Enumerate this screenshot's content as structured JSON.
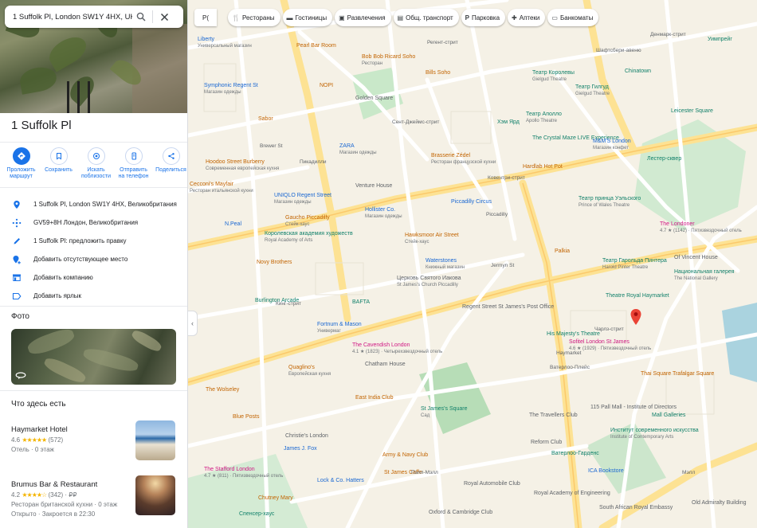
{
  "search": {
    "value": "1 Suffolk Pl, London SW1Y 4HX, UK"
  },
  "place": {
    "title": "1 Suffolk Pl"
  },
  "actions": [
    {
      "label": "Проложить маршрут",
      "icon": "directions-icon"
    },
    {
      "label": "Сохранить",
      "icon": "bookmark-icon"
    },
    {
      "label": "Искать поблизости",
      "icon": "nearby-icon"
    },
    {
      "label": "Отправить на телефон",
      "icon": "phone-icon"
    },
    {
      "label": "Поделиться",
      "icon": "share-icon"
    }
  ],
  "info": [
    {
      "text": "1 Suffolk Pl, London SW1Y 4HX, Великобритания",
      "icon": "location-pin-icon"
    },
    {
      "text": "GV59+8H Лондон, Великобритания",
      "icon": "plus-code-icon"
    },
    {
      "text": "1 Suffolk Pl: предложить правку",
      "icon": "pencil-icon"
    },
    {
      "text": "Добавить отсутствующее место",
      "icon": "add-place-icon"
    },
    {
      "text": "Добавить компанию",
      "icon": "store-icon"
    },
    {
      "text": "Добавить ярлык",
      "icon": "label-icon"
    }
  ],
  "photos": {
    "heading": "Фото"
  },
  "here": {
    "heading": "Что здесь есть",
    "items": [
      {
        "name": "Haymarket Hotel",
        "rating": "4.6",
        "stars": "★★★★★",
        "reviews": "(572)",
        "line1": "Отель · 0 этаж",
        "line2": ""
      },
      {
        "name": "Brumus Bar & Restaurant",
        "rating": "4.2",
        "stars": "★★★★☆",
        "reviews": "(342) · ₽₽",
        "line1": "Ресторан британской кухни · 0 этаж",
        "line2": "Открыто · Закроется в 22:30"
      }
    ]
  },
  "map": {
    "layer_label": "Р(",
    "chips": [
      {
        "label": "Рестораны",
        "icon": "fork-knife-icon"
      },
      {
        "label": "Гостиницы",
        "icon": "bed-icon"
      },
      {
        "label": "Развлечения",
        "icon": "ticket-icon"
      },
      {
        "label": "Общ. транспорт",
        "icon": "bus-icon"
      },
      {
        "label": "Парковка",
        "icon": "parking-icon"
      },
      {
        "label": "Аптеки",
        "icon": "pharmacy-icon"
      },
      {
        "label": "Банкоматы",
        "icon": "atm-icon"
      }
    ],
    "labels": [
      {
        "text": "Liberty",
        "sub": "Универсальный магазин",
        "cls": "t-blue"
      },
      {
        "text": "Pearl Bar Room",
        "sub": "",
        "cls": "t-orange"
      },
      {
        "text": "Bob Bob Ricard Soho",
        "sub": "Ресторан",
        "cls": "t-orange"
      },
      {
        "text": "Bills Soho",
        "sub": "",
        "cls": "t-orange"
      },
      {
        "text": "Театр Королевы",
        "sub": "Gielgud Theatre",
        "cls": "t-teal"
      },
      {
        "text": "Театр Гилгуд",
        "sub": "Gielgud Theatre",
        "cls": "t-teal"
      },
      {
        "text": "Chinatown",
        "sub": "",
        "cls": "t-teal"
      },
      {
        "text": "Уимпрейг",
        "sub": "",
        "cls": "t-teal"
      },
      {
        "text": "Symphonic Regent St",
        "sub": "Магазин одежды",
        "cls": "t-blue"
      },
      {
        "text": "NOPI",
        "sub": "",
        "cls": "t-orange"
      },
      {
        "text": "Golden Square",
        "sub": "",
        "cls": "t-grey"
      },
      {
        "text": "Театр Аполло",
        "sub": "Apollo Theatre",
        "cls": "t-teal"
      },
      {
        "text": "Sabor",
        "sub": "",
        "cls": "t-orange"
      },
      {
        "text": "Хэм Ярд",
        "sub": "",
        "cls": "t-teal"
      },
      {
        "text": "The Crystal Maze LIVE Experience",
        "sub": "",
        "cls": "t-teal"
      },
      {
        "text": "M&M'S London",
        "sub": "Магазин конфет",
        "cls": "t-blue"
      },
      {
        "text": "Leicester Square",
        "sub": "",
        "cls": "t-teal"
      },
      {
        "text": "ZARA",
        "sub": "Магазин одежды",
        "cls": "t-blue"
      },
      {
        "text": "Hoodoo Street Burberry",
        "sub": "Современная европейская кухня",
        "cls": "t-orange"
      },
      {
        "text": "Brasserie Zédel",
        "sub": "Ресторан французской кухни",
        "cls": "t-orange"
      },
      {
        "text": "Hardlab Hot Pot",
        "sub": "",
        "cls": "t-orange"
      },
      {
        "text": "Лестер-сквер",
        "sub": "",
        "cls": "t-teal"
      },
      {
        "text": "Театр принца Уэльского",
        "sub": "Prince of Wales Theatre",
        "cls": "t-teal"
      },
      {
        "text": "Cecconi's Mayfair",
        "sub": "Ресторан итальянской кухни",
        "cls": "t-orange"
      },
      {
        "text": "UNIQLO Regent Street",
        "sub": "Магазин одежды",
        "cls": "t-blue"
      },
      {
        "text": "Venture House",
        "sub": "",
        "cls": "t-grey"
      },
      {
        "text": "Piccadilly Circus",
        "sub": "",
        "cls": "t-blue"
      },
      {
        "text": "Piccadilly",
        "sub": "",
        "cls": "t-street"
      },
      {
        "text": "Hollister Co.",
        "sub": "Магазин одежды",
        "cls": "t-blue"
      },
      {
        "text": "Gaucho Piccadilly",
        "sub": "Стейк-хаус",
        "cls": "t-orange"
      },
      {
        "text": "Hawksmoor Air Street",
        "sub": "Стейк-хаус",
        "cls": "t-orange"
      },
      {
        "text": "The Londoner",
        "sub": "4.7 ★ (1142) · Пятизвездочный отель",
        "cls": "t-pink"
      },
      {
        "text": "N.Peal",
        "sub": "",
        "cls": "t-blue"
      },
      {
        "text": "Королевская академия художеств",
        "sub": "Royal Academy of Arts",
        "cls": "t-teal"
      },
      {
        "text": "Palkia",
        "sub": "",
        "cls": "t-orange"
      },
      {
        "text": "Театр Гарольда Пинтера",
        "sub": "Harold Pinter Theatre",
        "cls": "t-teal"
      },
      {
        "text": "Of Vincent House",
        "sub": "",
        "cls": "t-grey"
      },
      {
        "text": "Novy Brothers",
        "sub": "",
        "cls": "t-orange"
      },
      {
        "text": "Waterstones",
        "sub": "Книжный магазин",
        "cls": "t-blue"
      },
      {
        "text": "Национальная галерея",
        "sub": "The National Gallery",
        "cls": "t-teal"
      },
      {
        "text": "Церковь Святого Иакова",
        "sub": "St James's Church Piccadilly",
        "cls": "t-grey"
      },
      {
        "text": "Theatre Royal Haymarket",
        "sub": "",
        "cls": "t-teal"
      },
      {
        "text": "Burlington Arcade",
        "sub": "",
        "cls": "t-teal"
      },
      {
        "text": "BAFTA",
        "sub": "",
        "cls": "t-teal"
      },
      {
        "text": "Regent Street St James's Post Office",
        "sub": "",
        "cls": "t-grey"
      },
      {
        "text": "Fortnum & Mason",
        "sub": "Универмаг",
        "cls": "t-blue"
      },
      {
        "text": "His Majesty's Theatre",
        "sub": "",
        "cls": "t-teal"
      },
      {
        "text": "Sofitel London St James",
        "sub": "4.6 ★ (1929) · Пятизвездочный отель",
        "cls": "t-pink"
      },
      {
        "text": "The Cavendish London",
        "sub": "4.1 ★ (1823) · Четырехзвездочный отель",
        "cls": "t-pink"
      },
      {
        "text": "Chatham House",
        "sub": "",
        "cls": "t-grey"
      },
      {
        "text": "Quaglino's",
        "sub": "Европейская кухня",
        "cls": "t-orange"
      },
      {
        "text": "The Wolseley",
        "sub": "",
        "cls": "t-orange"
      },
      {
        "text": "Thai Square Trafalgar Square",
        "sub": "",
        "cls": "t-orange"
      },
      {
        "text": "East India Club",
        "sub": "",
        "cls": "t-orange"
      },
      {
        "text": "St James's Square",
        "sub": "Сад",
        "cls": "t-teal"
      },
      {
        "text": "The Travellers Club",
        "sub": "",
        "cls": "t-grey"
      },
      {
        "text": "115 Pall Mall - Institute of Directors",
        "sub": "",
        "cls": "t-grey"
      },
      {
        "text": "Mall Galleries",
        "sub": "",
        "cls": "t-teal"
      },
      {
        "text": "Blue Posts",
        "sub": "",
        "cls": "t-orange"
      },
      {
        "text": "Christie's London",
        "sub": "",
        "cls": "t-grey"
      },
      {
        "text": "Reform Club",
        "sub": "",
        "cls": "t-grey"
      },
      {
        "text": "Институт современного искусства",
        "sub": "Institute of Contemporary Arts",
        "cls": "t-teal"
      },
      {
        "text": "James J. Fox",
        "sub": "",
        "cls": "t-blue"
      },
      {
        "text": "Army & Navy Club",
        "sub": "",
        "cls": "t-orange"
      },
      {
        "text": "Ватерлоо-Гарденс",
        "sub": "",
        "cls": "t-teal"
      },
      {
        "text": "The Stafford London",
        "sub": "4.7 ★ (811) · Пятизвездочный отель",
        "cls": "t-pink"
      },
      {
        "text": "St James Caffe",
        "sub": "",
        "cls": "t-orange"
      },
      {
        "text": "Royal Automobile Club",
        "sub": "",
        "cls": "t-grey"
      },
      {
        "text": "Royal Academy of Engineering",
        "sub": "",
        "cls": "t-grey"
      },
      {
        "text": "ICA Bookstore",
        "sub": "",
        "cls": "t-blue"
      },
      {
        "text": "Lock & Co. Hatters",
        "sub": "",
        "cls": "t-blue"
      },
      {
        "text": "Chutney Mary",
        "sub": "",
        "cls": "t-orange"
      },
      {
        "text": "Oxford & Cambridge Club",
        "sub": "",
        "cls": "t-grey"
      },
      {
        "text": "South African Royal Embassy",
        "sub": "",
        "cls": "t-grey"
      },
      {
        "text": "Old Admiralty Building",
        "sub": "",
        "cls": "t-grey"
      },
      {
        "text": "Спенсер-хаус",
        "sub": "",
        "cls": "t-teal"
      },
      {
        "text": "Jermyn St",
        "sub": "",
        "cls": "t-street"
      },
      {
        "text": "Пэлл-Мэлл",
        "sub": "",
        "cls": "t-street"
      },
      {
        "text": "Ватерлоо-Плейс",
        "sub": "",
        "cls": "t-street"
      },
      {
        "text": "Ковентри-стрит",
        "sub": "",
        "cls": "t-street"
      },
      {
        "text": "Денмарк-стрит",
        "sub": "",
        "cls": "t-street"
      },
      {
        "text": "Чарлз-стрит",
        "sub": "",
        "cls": "t-street"
      },
      {
        "text": "Пикадилли",
        "sub": "",
        "cls": "t-street"
      },
      {
        "text": "Сент-Джеймс-стрит",
        "sub": "",
        "cls": "t-street"
      },
      {
        "text": "Кинг-стрит",
        "sub": "",
        "cls": "t-street"
      },
      {
        "text": "Мэлл",
        "sub": "",
        "cls": "t-street"
      },
      {
        "text": "Шафтсбери-авеню",
        "sub": "",
        "cls": "t-street"
      },
      {
        "text": "Brewer St",
        "sub": "",
        "cls": "t-street"
      },
      {
        "text": "Регент-стрит",
        "sub": "",
        "cls": "t-street"
      },
      {
        "text": "Haymarket",
        "sub": "",
        "cls": "t-street"
      }
    ]
  }
}
